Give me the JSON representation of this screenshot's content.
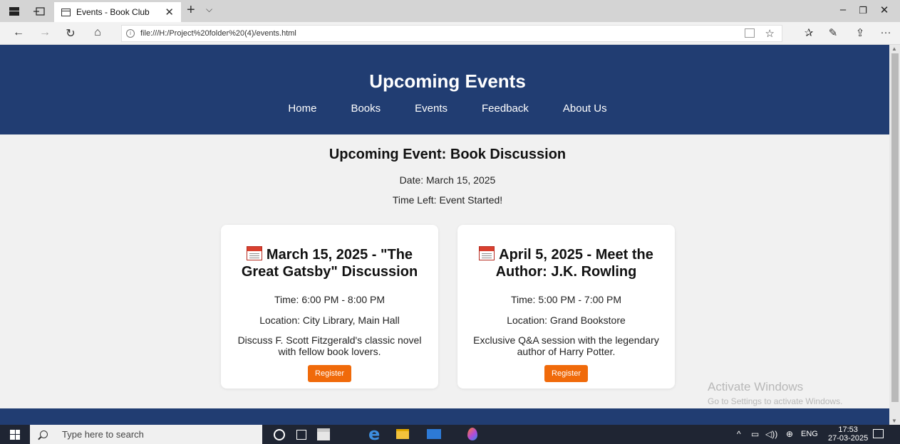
{
  "browser": {
    "tab_title": "Events - Book Club",
    "tab_close": "✕",
    "new_tab": "+",
    "tab_menu": "⌵",
    "url": "file:///H:/Project%20folder%20(4)/events.html",
    "window_controls": {
      "minimize": "–",
      "maximize": "❐",
      "close": "✕"
    },
    "nav": {
      "back": "←",
      "forward": "→",
      "refresh": "↻",
      "home": "⌂"
    },
    "tools": {
      "favorites_bar": "☆",
      "reading_list": "✰",
      "notes": "✎",
      "share": "⇪",
      "more": "···"
    },
    "icons": [
      "back-icon",
      "forward-icon",
      "refresh-icon",
      "home-icon",
      "info-icon",
      "reading-view-icon",
      "favorite-star-icon",
      "favorites-icon",
      "pen-icon",
      "share-icon",
      "more-icon"
    ]
  },
  "site": {
    "title": "Upcoming Events",
    "nav": [
      "Home",
      "Books",
      "Events",
      "Feedback",
      "About Us"
    ],
    "header_color": "#213d72",
    "button_color": "#f06a0a"
  },
  "countdown": {
    "title": "Upcoming Event: Book Discussion",
    "date": "Date: March 15, 2025",
    "time_left": "Time Left: Event Started!"
  },
  "events": [
    {
      "title": "March 15, 2025 - \"The Great Gatsby\" Discussion",
      "time": "Time: 6:00 PM - 8:00 PM",
      "location": "Location: City Library, Main Hall",
      "description": "Discuss F. Scott Fitzgerald's classic novel with fellow book lovers.",
      "button": "Register",
      "icon": "calendar-icon"
    },
    {
      "title": "April 5, 2025 - Meet the Author: J.K. Rowling",
      "time": "Time: 5:00 PM - 7:00 PM",
      "location": "Location: Grand Bookstore",
      "description": "Exclusive Q&A session with the legendary author of Harry Potter.",
      "button": "Register",
      "icon": "calendar-icon"
    }
  ],
  "watermark": {
    "title": "Activate Windows",
    "subtitle": "Go to Settings to activate Windows."
  },
  "taskbar": {
    "search_placeholder": "Type here to search",
    "tray_chevron": "^",
    "tray_battery": "▭",
    "tray_volume": "◁))",
    "tray_network": "⊕",
    "language": "ENG",
    "time": "17:53",
    "date": "27-03-2025"
  }
}
